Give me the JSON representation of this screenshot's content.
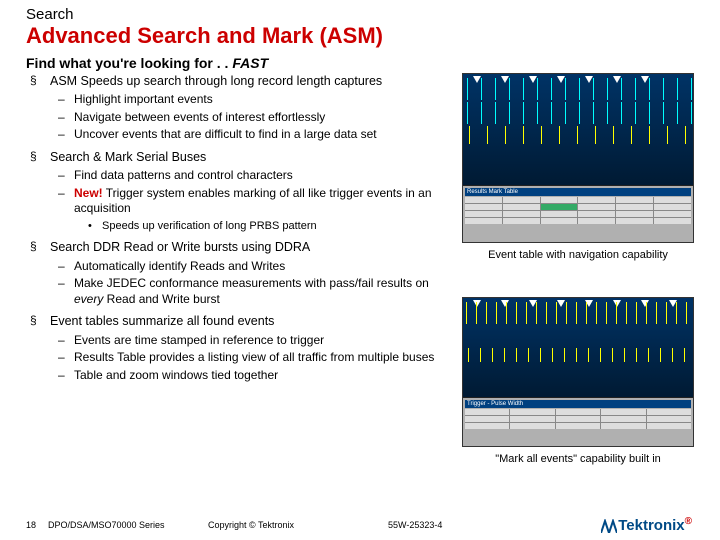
{
  "kicker": "Search",
  "title": "Advanced Search and Mark (ASM)",
  "lead_a": "Find what you're looking for . .  ",
  "lead_b": "FAST",
  "bullets": {
    "b1": "ASM Speeds up search through long record length captures",
    "b1_subs": {
      "s1": "Highlight important events",
      "s2": "Navigate between events of interest effortlessly",
      "s3": "Uncover events that are difficult to find in a large data set"
    },
    "b2": "Search & Mark Serial Buses",
    "b2_subs": {
      "s1": "Find data patterns and control characters",
      "s2_new": "New!",
      "s2_rest": " Trigger system enables marking of all like trigger events in an acquisition",
      "s2_sub": "Speeds up verification of long PRBS pattern"
    },
    "b3": "Search DDR Read or Write bursts using DDRA",
    "b3_subs": {
      "s1": "Automatically identify Reads and Writes",
      "s2_a": "Make JEDEC conformance measurements with pass/fail results on ",
      "s2_every": "every",
      "s2_b": " Read and Write burst"
    },
    "b4": "Event tables summarize all found events",
    "b4_subs": {
      "s1": "Events are time stamped in reference to trigger",
      "s2": "Results Table provides a listing view of all traffic from multiple buses",
      "s3": "Table and zoom windows tied together"
    }
  },
  "caption1": "Event table with navigation capability",
  "caption2": "\"Mark all events\" capability built in",
  "footer": {
    "page": "18",
    "series": "DPO/DSA/MSO70000 Series",
    "copyright": "Copyright © Tektronix",
    "docnum": "55W-25323-4",
    "logo": "Tektronix"
  }
}
